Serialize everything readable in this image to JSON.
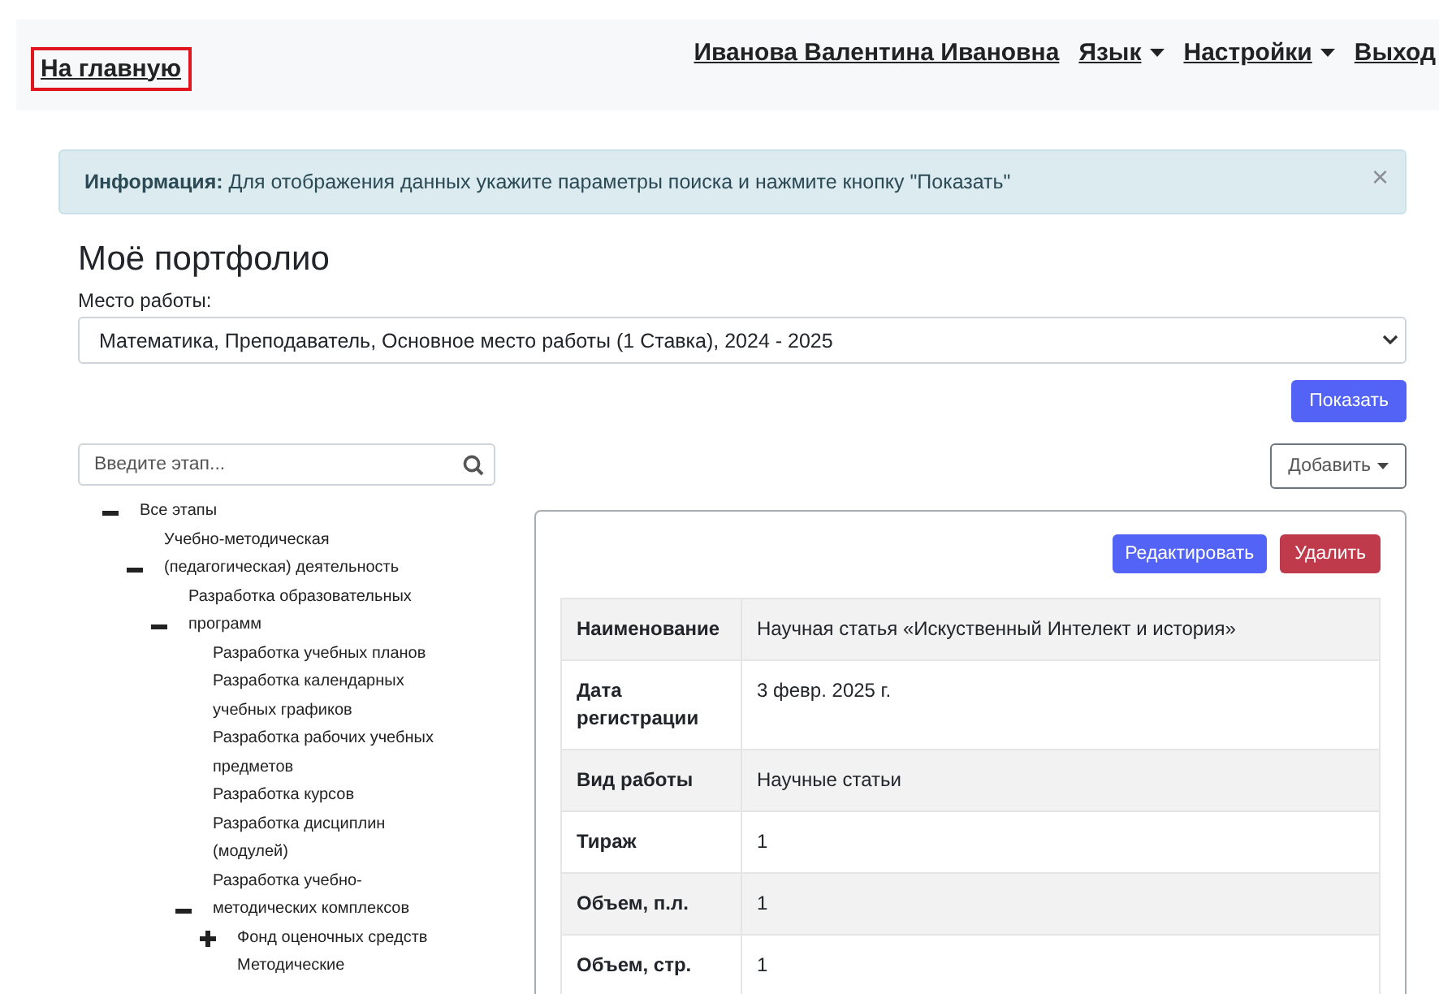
{
  "navbar": {
    "home_link": "На главную",
    "links": [
      {
        "label": "Иванова Валентина Ивановна",
        "dropdown": false
      },
      {
        "label": "Язык",
        "dropdown": true
      },
      {
        "label": "Настройки",
        "dropdown": true
      },
      {
        "label": "Выход",
        "dropdown": false
      }
    ]
  },
  "alert": {
    "title": "Информация:",
    "text": "Для отображения данных укажите параметры поиска и нажмите кнопку \"Показать\"",
    "close": "×"
  },
  "page_title": "Моё портфолио",
  "workplace": {
    "label": "Место работы:",
    "value": "Математика, Преподаватель, Основное место работы (1 Ставка), 2024 - 2025"
  },
  "show_button": "Показать",
  "search": {
    "placeholder": "Введите этап..."
  },
  "add_button": "Добавить",
  "tree": [
    {
      "label": "Все этапы",
      "expanded": true,
      "children": [
        {
          "label": "Учебно-методическая (педагогическая) деятельность",
          "expanded": true,
          "children": [
            {
              "label": "Разработка образовательных программ",
              "expanded": true,
              "children": [
                {
                  "label": "Разработка учебных планов"
                },
                {
                  "label": "Разработка календарных учебных графиков"
                },
                {
                  "label": "Разработка рабочих учебных предметов"
                },
                {
                  "label": "Разработка курсов"
                },
                {
                  "label": "Разработка дисциплин (модулей)"
                },
                {
                  "label": "Разработка учебно-методических комплексов",
                  "expanded": true,
                  "children": [
                    {
                      "label": "Фонд оценочных средств",
                      "expanded": false
                    },
                    {
                      "label": "Методические"
                    }
                  ]
                }
              ]
            }
          ]
        }
      ]
    }
  ],
  "detail": {
    "buttons": [
      {
        "label": "Редактировать",
        "kind": "primary"
      },
      {
        "label": "Удалить",
        "kind": "danger"
      }
    ],
    "rows": [
      {
        "name": "Наименование",
        "value": "Научная статья «Искуственный Интелект и история»"
      },
      {
        "name": "Дата регистрации",
        "value": "3 февр. 2025 г."
      },
      {
        "name": "Вид работы",
        "value": "Научные статьи"
      },
      {
        "name": "Тираж",
        "value": "1"
      },
      {
        "name": "Объем, п.л.",
        "value": "1"
      },
      {
        "name": "Объем, стр.",
        "value": "1"
      }
    ]
  }
}
